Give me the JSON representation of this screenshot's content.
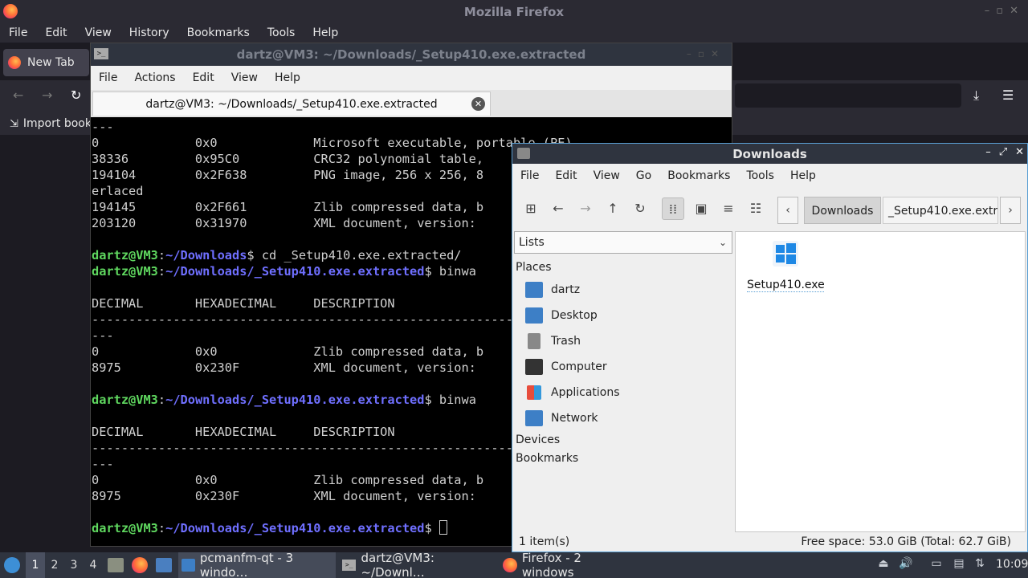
{
  "firefox": {
    "window_title": "Mozilla Firefox",
    "menu": [
      "File",
      "Edit",
      "View",
      "History",
      "Bookmarks",
      "Tools",
      "Help"
    ],
    "tab_label": "New Tab",
    "bookmark_label": "Import book"
  },
  "terminal": {
    "window_title": "dartz@VM3: ~/Downloads/_Setup410.exe.extracted",
    "title_icon": ">_",
    "menu": [
      "File",
      "Actions",
      "Edit",
      "View",
      "Help"
    ],
    "tab_label": "dartz@VM3: ~/Downloads/_Setup410.exe.extracted",
    "lines": [
      {
        "text": "---"
      },
      {
        "text": "0             0x0             Microsoft executable, portable (PE)"
      },
      {
        "text": "38336         0x95C0          CRC32 polynomial table,"
      },
      {
        "text": "194104        0x2F638         PNG image, 256 x 256, 8"
      },
      {
        "text": "erlaced"
      },
      {
        "text": "194145        0x2F661         Zlib compressed data, b"
      },
      {
        "text": "203120        0x31970         XML document, version: "
      },
      {
        "text": ""
      },
      {
        "prompt_user": "dartz@VM3",
        "prompt_path": "~/Downloads",
        "cmd": "$ cd _Setup410.exe.extracted/"
      },
      {
        "prompt_user": "dartz@VM3",
        "prompt_path": "~/Downloads/_Setup410.exe.extracted",
        "cmd": "$ binwa"
      },
      {
        "text": ""
      },
      {
        "text": "DECIMAL       HEXADECIMAL     DESCRIPTION"
      },
      {
        "text": "--------------------------------------------------------------------------"
      },
      {
        "text": "---"
      },
      {
        "text": "0             0x0             Zlib compressed data, b"
      },
      {
        "text": "8975          0x230F          XML document, version: "
      },
      {
        "text": ""
      },
      {
        "prompt_user": "dartz@VM3",
        "prompt_path": "~/Downloads/_Setup410.exe.extracted",
        "cmd": "$ binwa"
      },
      {
        "text": ""
      },
      {
        "text": "DECIMAL       HEXADECIMAL     DESCRIPTION"
      },
      {
        "text": "--------------------------------------------------------------------------"
      },
      {
        "text": "---"
      },
      {
        "text": "0             0x0             Zlib compressed data, b"
      },
      {
        "text": "8975          0x230F          XML document, version: "
      },
      {
        "text": ""
      },
      {
        "prompt_user": "dartz@VM3",
        "prompt_path": "~/Downloads/_Setup410.exe.extracted",
        "cmd": "$ ",
        "cursor": true
      }
    ]
  },
  "filemanager": {
    "window_title": "Downloads",
    "menu": [
      "File",
      "Edit",
      "View",
      "Go",
      "Bookmarks",
      "Tools",
      "Help"
    ],
    "crumbs": [
      "Downloads",
      "_Setup410.exe.extr"
    ],
    "sidebar_mode": "Lists",
    "sections": {
      "places": "Places",
      "devices": "Devices",
      "bookmarks": "Bookmarks"
    },
    "places": [
      {
        "label": "dartz",
        "icon": "home-folder-icon",
        "color": "#3d7fc6"
      },
      {
        "label": "Desktop",
        "icon": "desktop-icon",
        "color": "#3d7fc6"
      },
      {
        "label": "Trash",
        "icon": "trash-icon",
        "color": "#777777"
      },
      {
        "label": "Computer",
        "icon": "computer-icon",
        "color": "#333333"
      },
      {
        "label": "Applications",
        "icon": "applications-icon",
        "color": "#e74c3c"
      },
      {
        "label": "Network",
        "icon": "network-icon",
        "color": "#3d7fc6"
      }
    ],
    "files": [
      {
        "name": "Setup410.exe",
        "icon": "windows-exe-icon"
      }
    ],
    "status_left": "1 item(s)",
    "status_right": "Free space: 53.0 GiB (Total: 62.7 GiB)"
  },
  "taskbar": {
    "workspaces": [
      "1",
      "2",
      "3",
      "4"
    ],
    "tasks": [
      {
        "label": "pcmanfm-qt - 3 windo…"
      },
      {
        "label": "dartz@VM3: ~/Downl…"
      },
      {
        "label": "Firefox - 2 windows"
      }
    ],
    "clock": "10:09"
  }
}
